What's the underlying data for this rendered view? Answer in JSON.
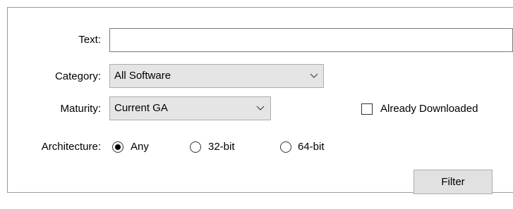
{
  "form": {
    "text": {
      "label": "Text:",
      "value": ""
    },
    "category": {
      "label": "Category:",
      "selected": "All Software"
    },
    "maturity": {
      "label": "Maturity:",
      "selected": "Current GA"
    },
    "already_downloaded": {
      "label": "Already Downloaded",
      "checked": false
    },
    "architecture": {
      "label": "Architecture:",
      "options": [
        "Any",
        "32-bit",
        "64-bit"
      ],
      "selected": "Any"
    },
    "filter_button": "Filter"
  },
  "icons": {
    "dropdown": "chevron-down-icon"
  },
  "colors": {
    "panel_border": "#9a9a9a",
    "select_background": "#e5e5e5",
    "button_background": "#e1e1e1"
  }
}
